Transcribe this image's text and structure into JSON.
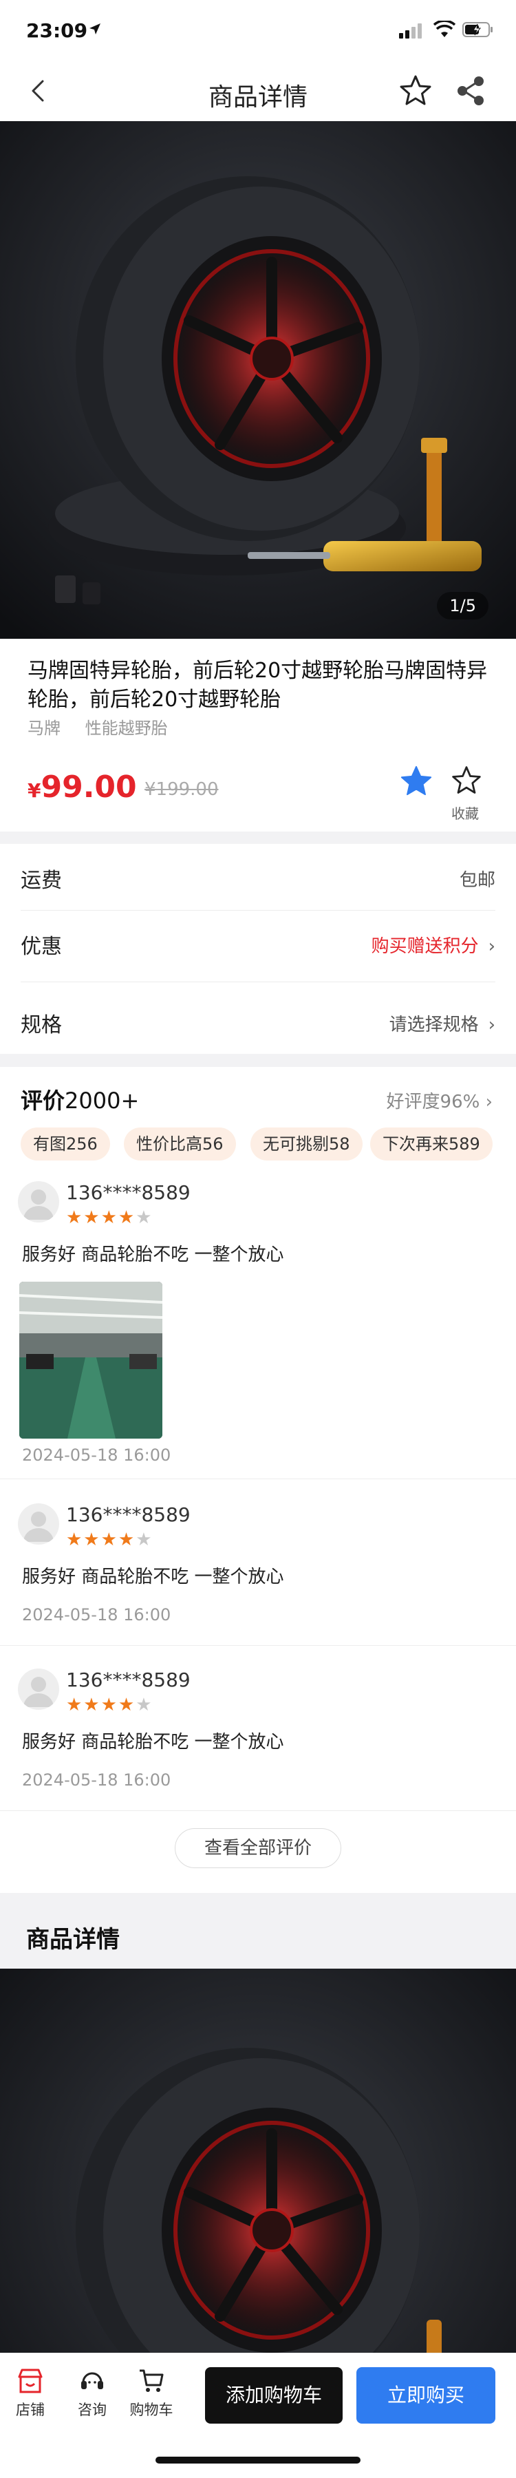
{
  "status": {
    "time": "23:09"
  },
  "nav": {
    "title": "商品详情"
  },
  "hero": {
    "counter": "1/5"
  },
  "product": {
    "name": "马牌固特异轮胎，前后轮20寸越野轮胎马牌固特异轮胎，前后轮20寸越野轮胎",
    "tags": [
      "马牌",
      "性能越野胎"
    ],
    "price_symbol": "¥",
    "price": "99.00",
    "original_price": "¥199.00",
    "fav_label": "收藏"
  },
  "specs": {
    "shipping_label": "运费",
    "shipping_value": "包邮",
    "promo_label": "优惠",
    "promo_value": "购买赠送积分",
    "spec_label": "规格",
    "spec_value": "请选择规格"
  },
  "reviews": {
    "title": "评价",
    "count": "2000+",
    "rating": "好评度96%",
    "chips": [
      "有图256",
      "性价比高56",
      "无可挑剔58",
      "下次再来589"
    ],
    "items": [
      {
        "user": "136****8589",
        "stars": 4,
        "text": "服务好 商品轮胎不吃 一整个放心",
        "date": "2024-05-18 16:00"
      },
      {
        "user": "136****8589",
        "stars": 4,
        "text": "服务好 商品轮胎不吃 一整个放心",
        "date": "2024-05-18 16:00"
      },
      {
        "user": "136****8589",
        "stars": 4,
        "text": "服务好 商品轮胎不吃 一整个放心",
        "date": "2024-05-18 16:00"
      }
    ],
    "view_all": "查看全部评价"
  },
  "detail": {
    "title": "商品详情"
  },
  "bottom": {
    "tabs": [
      "店铺",
      "咨询",
      "购物车"
    ],
    "add_cart": "添加购物车",
    "buy_now": "立即购买"
  },
  "colors": {
    "accent_red": "#e5242b",
    "accent_blue": "#2f7cf0",
    "star_orange": "#f07a1a",
    "chip_bg": "#fdeee4"
  }
}
